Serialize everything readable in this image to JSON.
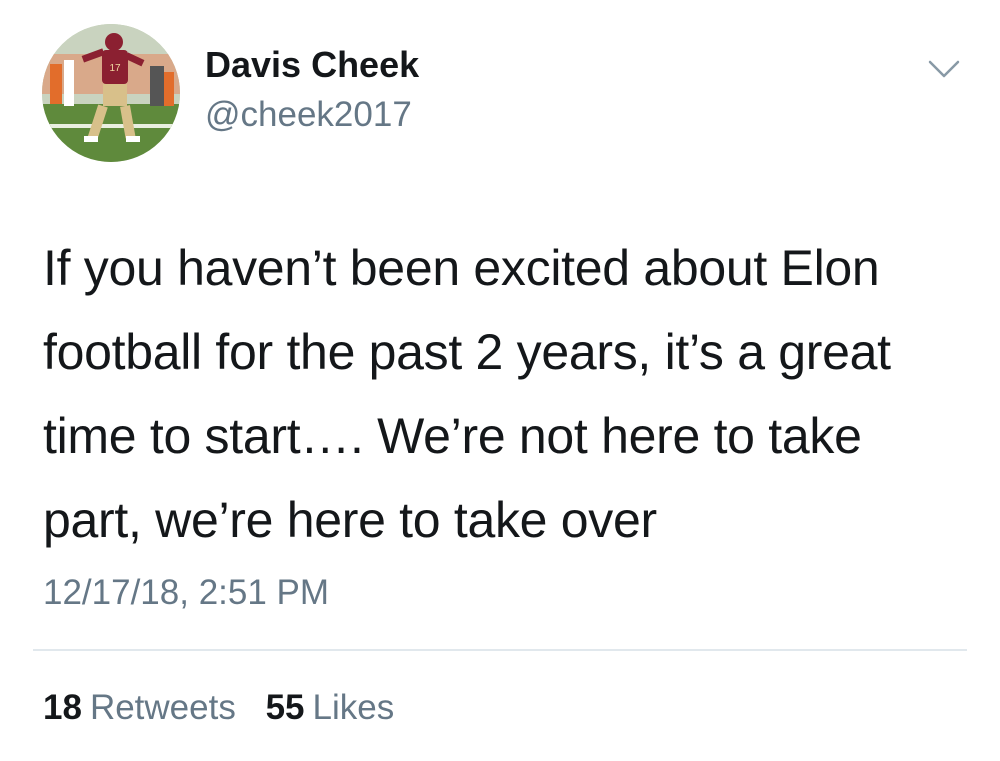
{
  "tweet": {
    "author": {
      "name": "Davis Cheek",
      "handle": "@cheek2017"
    },
    "menu_icon": "chevron-down-icon",
    "text_lines": [
      "If you haven’t been excited about Elon",
      "football for the past 2 years, it’s a great",
      "time to start…. We’re not here to take",
      "part, we’re here to take over"
    ],
    "timestamp": "12/17/18, 2:51 PM",
    "stats": {
      "retweets_count": "18",
      "retweets_label": "Retweets",
      "likes_count": "55",
      "likes_label": "Likes"
    }
  },
  "colors": {
    "primary_text": "#14171a",
    "secondary_text": "#657786",
    "divider": "#e1e8ed"
  }
}
